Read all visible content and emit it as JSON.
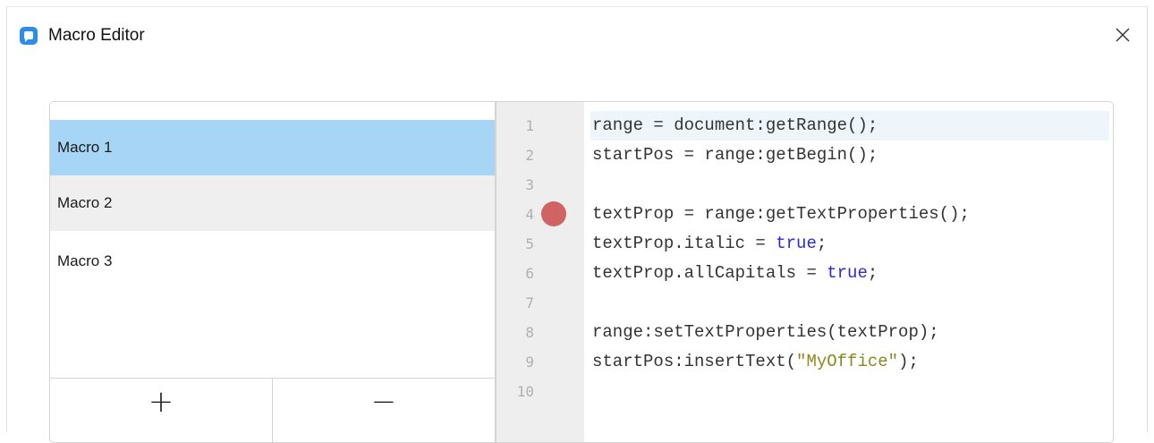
{
  "window": {
    "title": "Macro Editor",
    "icon": "myoffice-app-icon",
    "close_icon": "close-icon"
  },
  "macros": [
    {
      "label": "Macro 1",
      "state": "selected"
    },
    {
      "label": "Macro 2",
      "state": "hover"
    },
    {
      "label": "Macro 3",
      "state": "normal"
    }
  ],
  "list_buttons": {
    "add_label": "+",
    "remove_label": "−"
  },
  "editor": {
    "breakpoint_line": 4,
    "current_line": 1,
    "lines": [
      {
        "num": "1",
        "parts": [
          {
            "t": "range = document:getRange();",
            "c": "plain"
          }
        ]
      },
      {
        "num": "2",
        "parts": [
          {
            "t": "startPos = range:getBegin();",
            "c": "plain"
          }
        ]
      },
      {
        "num": "3",
        "parts": []
      },
      {
        "num": "4",
        "parts": [
          {
            "t": "textProp = range:getTextProperties();",
            "c": "plain"
          }
        ]
      },
      {
        "num": "5",
        "parts": [
          {
            "t": "textProp.italic = ",
            "c": "plain"
          },
          {
            "t": "true",
            "c": "kw"
          },
          {
            "t": ";",
            "c": "plain"
          }
        ]
      },
      {
        "num": "6",
        "parts": [
          {
            "t": "textProp.allCapitals = ",
            "c": "plain"
          },
          {
            "t": "true",
            "c": "kw"
          },
          {
            "t": ";",
            "c": "plain"
          }
        ]
      },
      {
        "num": "7",
        "parts": []
      },
      {
        "num": "8",
        "parts": [
          {
            "t": "range:setTextProperties(textProp);",
            "c": "plain"
          }
        ]
      },
      {
        "num": "9",
        "parts": [
          {
            "t": "startPos:insertText(",
            "c": "plain"
          },
          {
            "t": "\"MyOffice\"",
            "c": "str"
          },
          {
            "t": ");",
            "c": "plain"
          }
        ]
      },
      {
        "num": "10",
        "parts": []
      }
    ]
  },
  "colors": {
    "selected_bg": "#a6d5f5",
    "hover_bg": "#efefef",
    "keyword": "#2b2bd6",
    "string": "#8a8a1e",
    "breakpoint": "#d06464",
    "app_icon": "#2b8fe8"
  }
}
